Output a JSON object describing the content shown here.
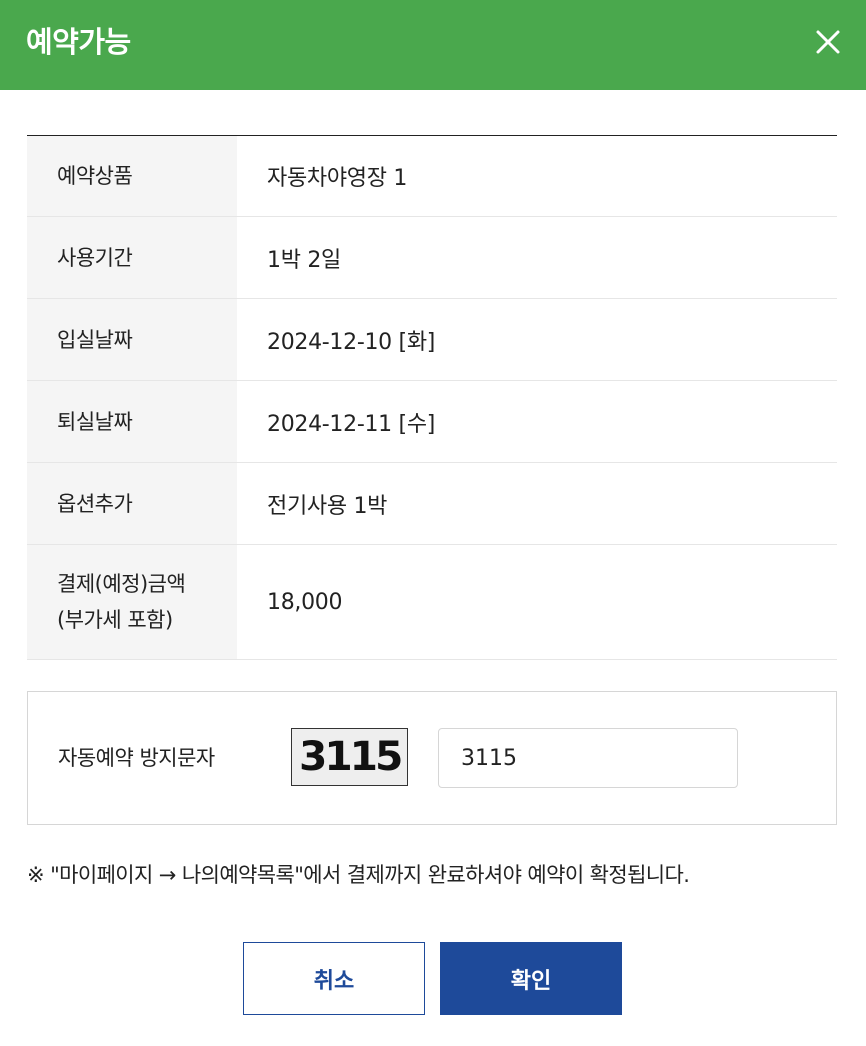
{
  "header": {
    "title": "예약가능",
    "close_icon": "close-icon"
  },
  "reservation": {
    "rows": [
      {
        "label": "예약상품",
        "value": "자동차야영장 1"
      },
      {
        "label": "사용기간",
        "value": "1박 2일"
      },
      {
        "label": "입실날짜",
        "value": "2024-12-10 [화]"
      },
      {
        "label": "퇴실날짜",
        "value": "2024-12-11 [수]"
      },
      {
        "label": "옵션추가",
        "value": "전기사용 1박"
      },
      {
        "label_line1": "결제(예정)금액",
        "label_line2": "(부가세 포함)",
        "value": "18,000"
      }
    ]
  },
  "captcha": {
    "label": "자동예약 방지문자",
    "image_text": "3115",
    "input_value": "3115"
  },
  "notice": "※ \"마이페이지 → 나의예약목록\"에서 결제까지 완료하셔야 예약이 확정됩니다.",
  "buttons": {
    "cancel_label": "취소",
    "confirm_label": "확인"
  },
  "colors": {
    "header_bg": "#4aa84d",
    "primary": "#1e4a9a",
    "label_bg": "#f5f5f5"
  }
}
